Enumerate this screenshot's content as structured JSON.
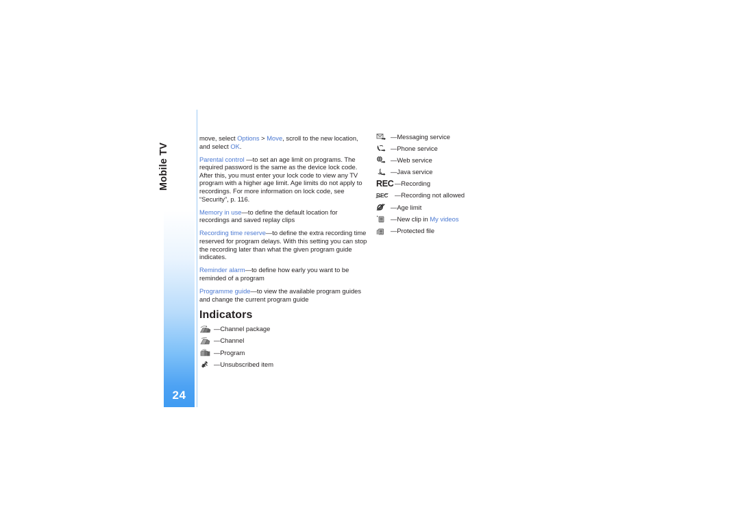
{
  "document": {
    "running_head": "Mobile TV",
    "page_number": "24",
    "accent_color": "#4b79d2",
    "tab_color": "#3f9bf2",
    "rule_color": "#9ecbf4"
  },
  "left_column": {
    "paragraphs": [
      {
        "id": "move-instruction",
        "segments": [
          {
            "text": "move, select ",
            "style": "plain"
          },
          {
            "text": "Options",
            "style": "link"
          },
          {
            "text": " > ",
            "style": "plain"
          },
          {
            "text": "Move",
            "style": "link"
          },
          {
            "text": ", scroll to the new location, and select ",
            "style": "plain"
          },
          {
            "text": "OK",
            "style": "link"
          },
          {
            "text": ".",
            "style": "plain"
          }
        ]
      },
      {
        "id": "parental-control",
        "segments": [
          {
            "text": "Parental control",
            "style": "link"
          },
          {
            "text": " —to set an age limit on programs. The required password is the same as the device lock code. After this, you must enter your lock code to view any TV program with a higher age limit. Age limits do not apply to recordings. For more information on lock code, see “Security”, p. 116.",
            "style": "plain"
          }
        ]
      },
      {
        "id": "memory-in-use",
        "segments": [
          {
            "text": "Memory in use",
            "style": "link"
          },
          {
            "text": "—to define the default location for recordings and saved replay clips",
            "style": "plain"
          }
        ]
      },
      {
        "id": "recording-time-reserve",
        "segments": [
          {
            "text": "Recording time reserve",
            "style": "link"
          },
          {
            "text": "—to define the extra recording time reserved for program delays. With this setting you can stop the recording later than what the given program guide indicates.",
            "style": "plain"
          }
        ]
      },
      {
        "id": "reminder-alarm",
        "segments": [
          {
            "text": "Reminder alarm",
            "style": "link"
          },
          {
            "text": "—to define how early you want to be reminded of a program",
            "style": "plain"
          }
        ]
      },
      {
        "id": "programme-guide",
        "segments": [
          {
            "text": "Programme guide",
            "style": "link"
          },
          {
            "text": "—to view the available program guides and change the current program guide",
            "style": "plain"
          }
        ]
      }
    ],
    "heading": "Indicators",
    "indicators": [
      {
        "icon": "channel-package-icon",
        "label": "—Channel package"
      },
      {
        "icon": "channel-icon",
        "label": "—Channel"
      },
      {
        "icon": "program-icon",
        "label": "—Program"
      },
      {
        "icon": "unsubscribed-item-icon",
        "label": "—Unsubscribed item"
      }
    ]
  },
  "right_column": {
    "indicators": [
      {
        "icon": "messaging-service-icon",
        "label": "—Messaging service"
      },
      {
        "icon": "phone-service-icon",
        "label": "—Phone service"
      },
      {
        "icon": "web-service-icon",
        "label": "—Web service"
      },
      {
        "icon": "java-service-icon",
        "label": "—Java service"
      },
      {
        "icon": "recording-icon",
        "label": "—Recording",
        "glyph_text": "REC"
      },
      {
        "icon": "recording-not-allowed-icon",
        "label": "—Recording not allowed",
        "glyph_text": "REC"
      },
      {
        "icon": "age-limit-icon",
        "label": "—Age limit"
      },
      {
        "icon": "new-clip-icon",
        "label": "—New clip in ",
        "link_text": "My videos"
      },
      {
        "icon": "protected-file-icon",
        "label": "—Protected file"
      }
    ]
  }
}
